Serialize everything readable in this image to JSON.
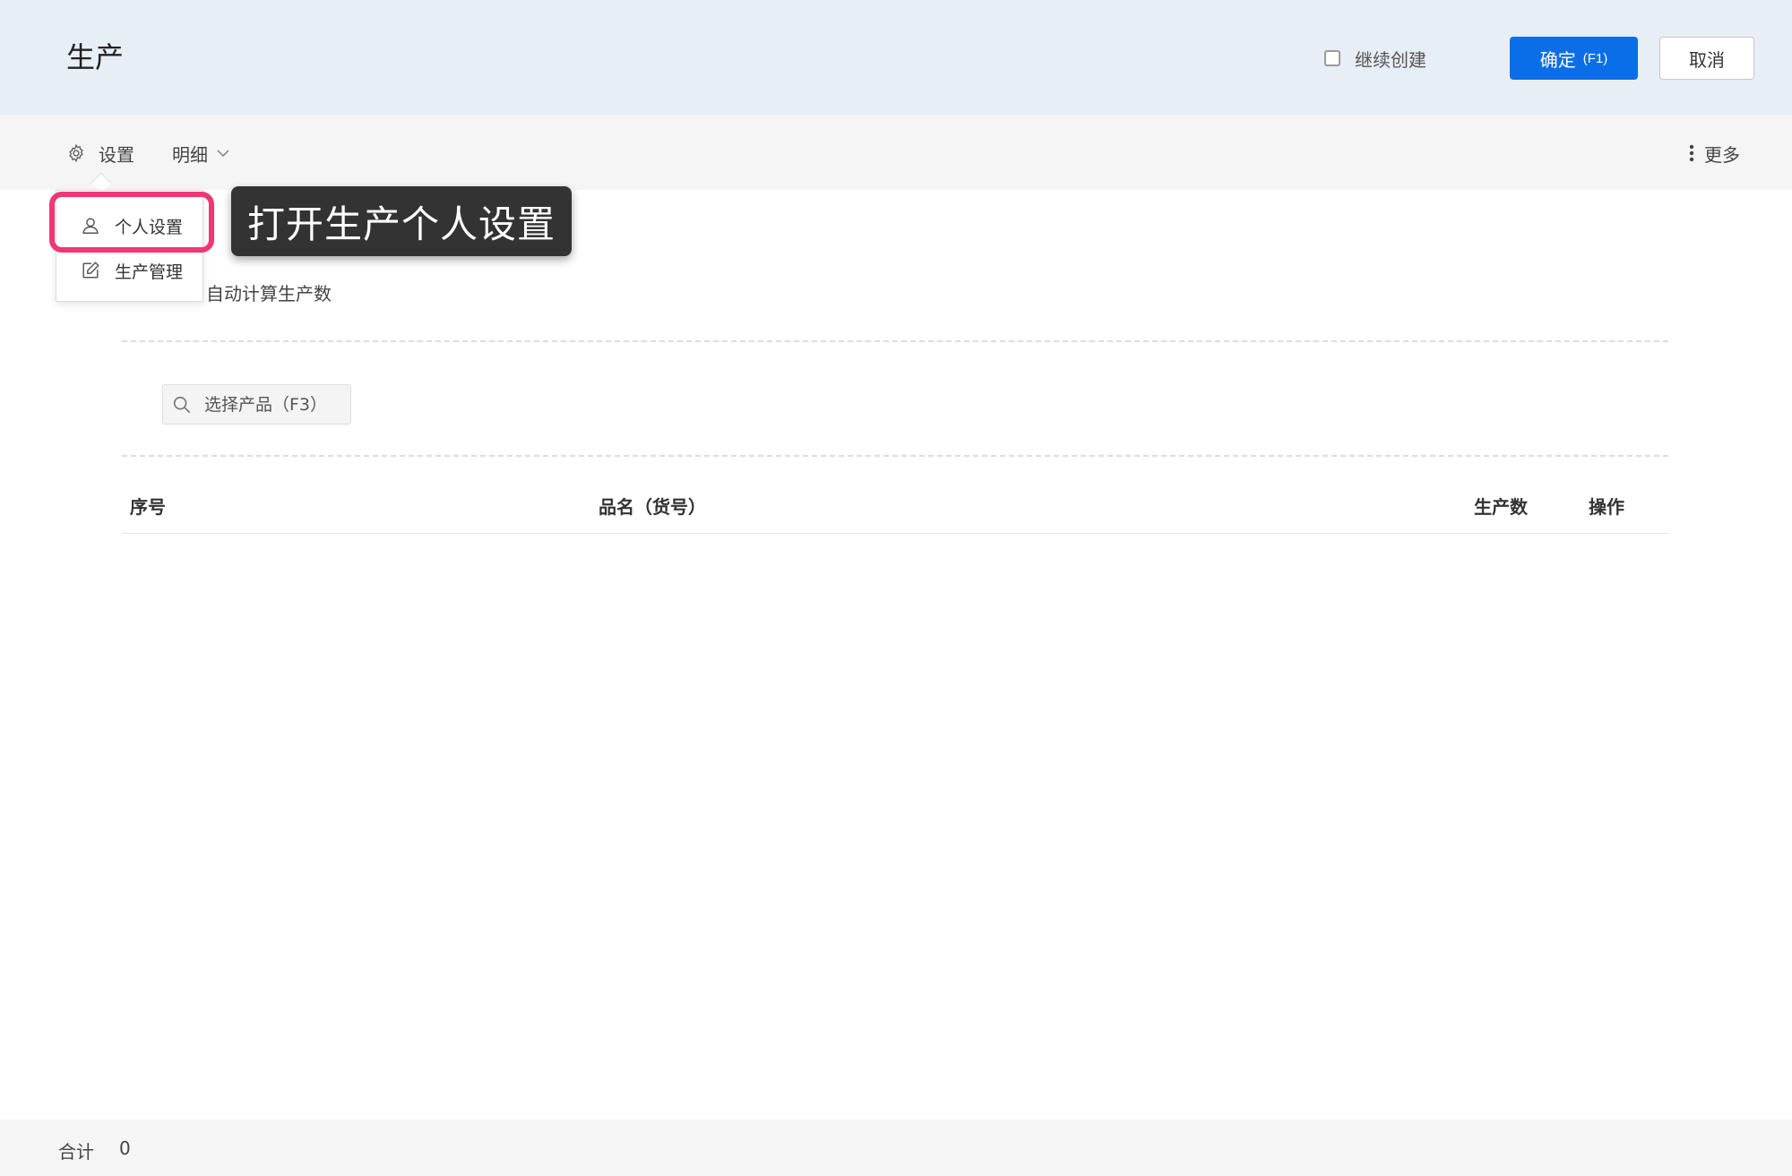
{
  "header": {
    "title": "生产",
    "continue_create_label": "继续创建",
    "continue_create_checked": false,
    "confirm_label": "确定",
    "confirm_shortcut": "(F1)",
    "cancel_label": "取消",
    "background": "#e8eef5",
    "accent": "#0a6ee8"
  },
  "toolbar": {
    "settings_label": "设置",
    "settings_icon": "gear-icon",
    "detail_label": "明细",
    "detail_icon": "chevron-down-icon",
    "more_label": "更多",
    "more_icon": "vertical-dots-icon"
  },
  "dropdown": {
    "items": [
      {
        "label": "个人设置",
        "icon": "user-icon"
      },
      {
        "label": "生产管理",
        "icon": "edit-icon"
      }
    ]
  },
  "tooltip": {
    "text": "打开生产个人设置",
    "highlight_color": "#f03674"
  },
  "form": {
    "auto_calc_label": "自动计算生产数"
  },
  "search": {
    "placeholder": "选择产品（F3）",
    "icon": "search-icon"
  },
  "table": {
    "columns": [
      "序号",
      "品名（货号）",
      "生产数",
      "操作"
    ],
    "rows": []
  },
  "footer": {
    "total_label": "合计",
    "total_value": "0"
  }
}
